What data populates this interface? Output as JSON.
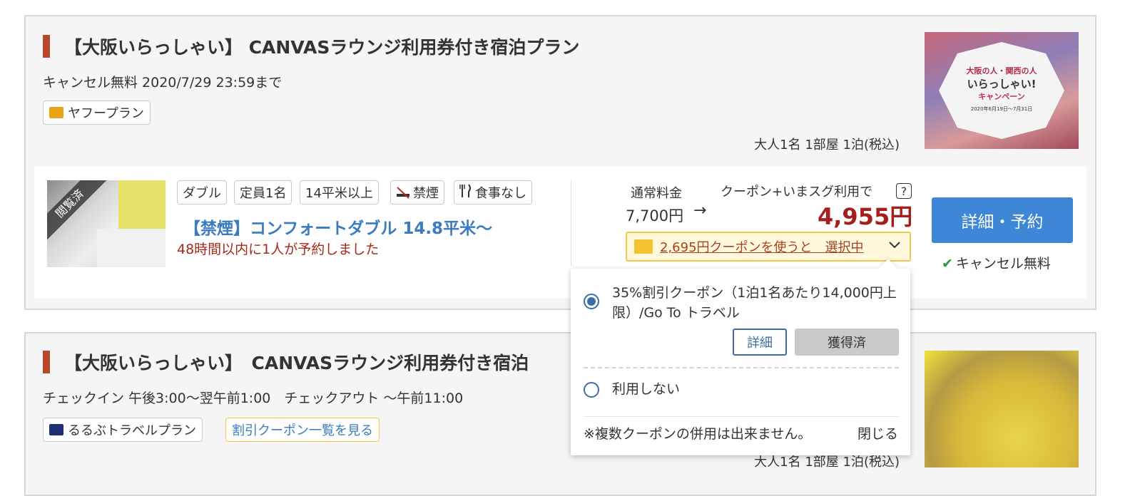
{
  "plan1": {
    "title": "【大阪いらっしゃい】 CANVASラウンジ利用券付き宿泊プラン",
    "cancel": "キャンセル無料 2020/7/29 23:59まで",
    "plan_tag": "ヤフープラン",
    "occupancy": "大人1名 1部屋 1泊(税込)",
    "room": {
      "viewed_badge": "閲覧済",
      "chips": [
        "ダブル",
        "定員1名",
        "14平米以上",
        "禁煙",
        "食事なし"
      ],
      "name": "【禁煙】コンフォートダブル 14.8平米〜",
      "booked_notice": "48時間以内に1人が予約しました",
      "regular_label": "通常料金",
      "regular_price": "7,700円",
      "arrow": "→",
      "coupon_label": "クーポン+いまスグ利用で",
      "help": "?",
      "final_price": "4,955円",
      "coupon_select": "2,695円クーポンを使うと　選択中",
      "book_button": "詳細・予約",
      "free_cancel": "キャンセル無料"
    }
  },
  "plan2": {
    "title": "【大阪いらっしゃい】　CANVASラウンジ利用券付き宿泊",
    "checkin": "チェックイン 午後3:00〜翌午前1:00　チェックアウト 〜午前11:00",
    "plan_tag": "るるぶトラベルプラン",
    "coupon_link": "割引クーポン一覧を見る",
    "occupancy": "大人1名 1部屋 1泊(税込)"
  },
  "dropdown": {
    "option1": "35%割引クーポン（1泊1名あたり14,000円上限）/Go To トラベル",
    "detail_button": "詳細",
    "acquired_button": "獲得済",
    "option2": "利用しない",
    "note": "※複数クーポンの併用は出来ません。",
    "close": "閉じる"
  },
  "thumb1": {
    "line1": "大阪の人・関西の人",
    "line2": "いらっしゃい!",
    "line3": "キャンペーン",
    "line4": "2020年6月19日〜7月31日"
  },
  "colors": {
    "accent_blue": "#3e86d6",
    "price_red": "#a51f1f",
    "coupon_yellow": "#f0c94b",
    "title_bar": "#b7472a"
  }
}
